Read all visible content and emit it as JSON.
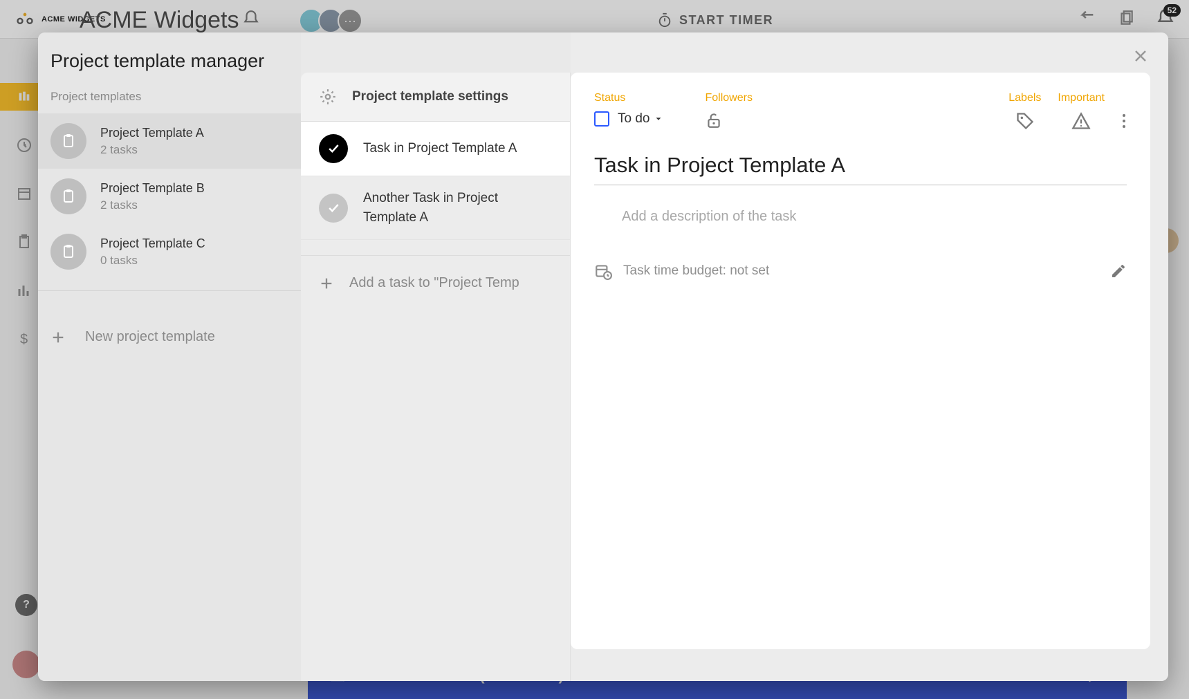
{
  "bg": {
    "logo_text": "ACME WIDGETS",
    "app_title": "ACME Widgets",
    "timer_label": "START TIMER",
    "notification_count": "52",
    "add_task_bar": "Add a new task (Ctrl+Enter)"
  },
  "modal": {
    "title": "Project template manager",
    "templates_header": "Project templates",
    "templates": [
      {
        "name": "Project Template A",
        "sub": "2 tasks"
      },
      {
        "name": "Project Template B",
        "sub": "2 tasks"
      },
      {
        "name": "Project Template C",
        "sub": "0 tasks"
      }
    ],
    "new_template_label": "New project template",
    "settings_label": "Project template settings",
    "tasks": [
      {
        "name": "Task in Project Template A"
      },
      {
        "name": "Another Task in Project Template A"
      }
    ],
    "add_task_label": "Add a task to \"Project Temp"
  },
  "detail": {
    "labels": {
      "status": "Status",
      "followers": "Followers",
      "labels": "Labels",
      "important": "Important"
    },
    "status_value": "To do",
    "task_title": "Task in Project Template A",
    "description_placeholder": "Add a description of the task",
    "time_budget": "Task time budget: not set"
  }
}
